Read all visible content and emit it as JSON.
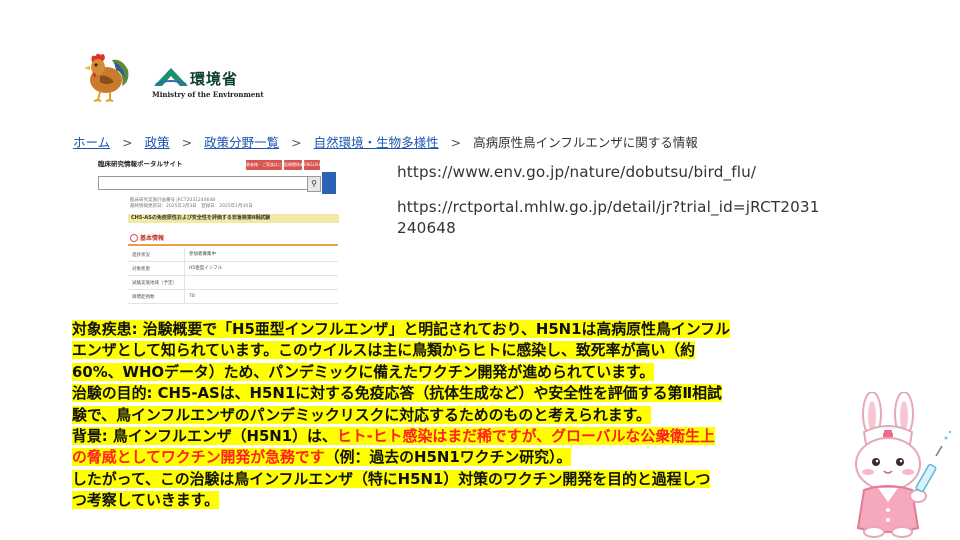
{
  "logos": {
    "rooster": "rooster-icon",
    "ministry_name_jp": "環境省",
    "ministry_name_en": "Ministry of the Environment"
  },
  "breadcrumb": {
    "items": [
      "ホーム",
      "政策",
      "政策分野一覧",
      "自然環境・生物多様性"
    ],
    "current": "高病原性鳥インフルエンザに関する情報",
    "separator": ">"
  },
  "portal": {
    "title": "臨床研究情報ポータルサイト",
    "header_buttons": [
      "患者様・ご家族はこちら",
      "医療関係者",
      "ENGLISH"
    ],
    "search_icon": "search-icon",
    "meta": [
      "臨床研究実施計画番号 jRCT2031240648",
      "最終情報更新日：2025年3月3日　登録日：2025年1月30日"
    ],
    "trial_name": "CH5-ASの免疫原性および安全性を評価する非盲検第Ⅱ相試験",
    "section": "基本情報",
    "rows": [
      {
        "k": "進捗状況",
        "v": "参加者募集中"
      },
      {
        "k": "対象疾患",
        "v": "H5亜型インフル"
      },
      {
        "k": "試験実施地域（予定）",
        "v": ""
      },
      {
        "k": "目標症例数",
        "v": "70"
      }
    ]
  },
  "urls": [
    "https://www.env.go.jp/nature/dobutsu/bird_flu/",
    "https://rctportal.mhlw.go.jp/detail/jr?trial_id=jRCT2031",
    "240648"
  ],
  "body": {
    "p1_line1": "対象疾患: 治験概要で「H5亜型インフルエンザ」と明記されており、H5N1は高病原性鳥インフル",
    "p1_line2": "エンザとして知られています。このウイルスは主に鳥類からヒトに感染し、致死率が高い（約",
    "p1_line3": "60%、WHOデータ）ため、パンデミックに備えたワクチン開発が進められています。",
    "p2_line1": "治験の目的: CH5-ASは、H5N1に対する免疫応答（抗体生成など）や安全性を評価する第Ⅱ相試",
    "p2_line2": "験で、鳥インフルエンザのパンデミックリスクに対応するためのものと考えられます。",
    "p3_prefix": "背景: 鳥インフルエンザ（H5N1）は、",
    "p3_red1": "ヒト-ヒト感染はまだ稀ですが、グローバルな公衆衛生上",
    "p3_red2": "の脅威としてワクチン開発が急務です",
    "p3_suffix": "（例：過去のH5N1ワクチン研究）。",
    "p4_line1": "したがって、この治験は鳥インフルエンザ（特にH5N1）対策のワクチン開発を目的と過程しつ",
    "p4_line2": "つ考察していきます。",
    "highlight_color": "#ffff00",
    "red_color": "#ff1f1f"
  },
  "illustration": "nurse-rabbit-icon"
}
